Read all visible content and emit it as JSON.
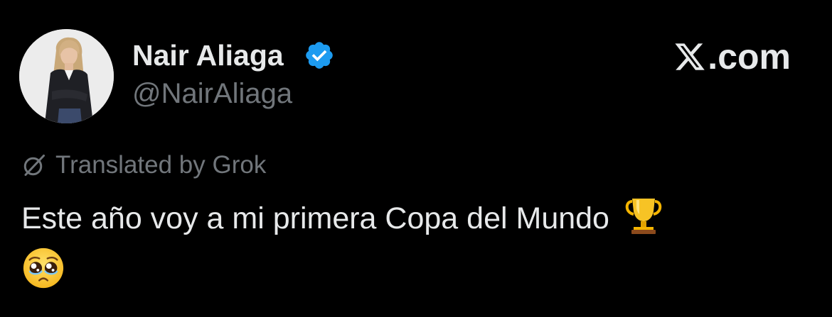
{
  "author": {
    "display_name": "Nair Aliaga",
    "handle": "@NairAliaga",
    "verified": true,
    "avatar": "profile-photo"
  },
  "brand": {
    "label": ".com",
    "logo": "x-logo"
  },
  "translation": {
    "label": "Translated by Grok",
    "icon": "grok-icon"
  },
  "tweet": {
    "text": "Este año voy a mi primera Copa del Mundo",
    "emojis": [
      "trophy-icon",
      "pleading-face-icon"
    ]
  },
  "colors": {
    "background": "#000000",
    "primary_text": "#e7e9ea",
    "secondary_text": "#71767b",
    "verified_badge": "#1d9bf0"
  }
}
